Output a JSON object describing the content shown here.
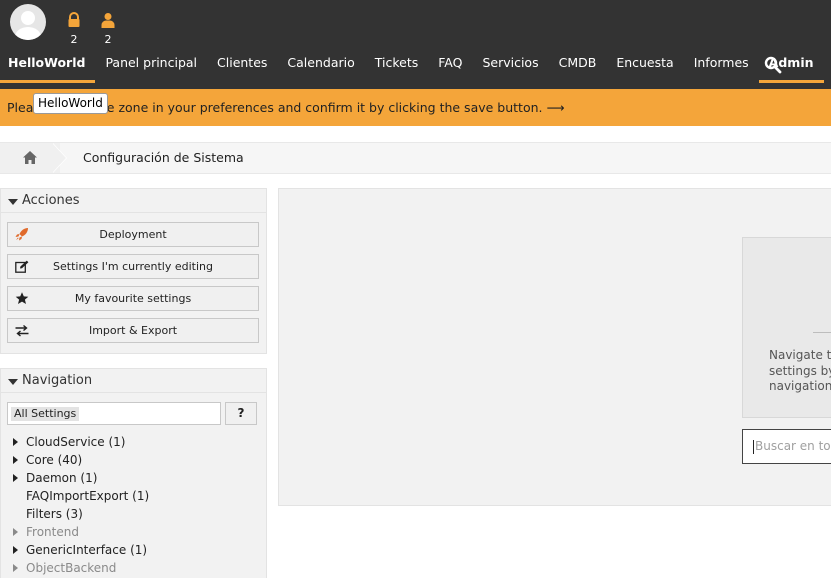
{
  "toolbar": {
    "locked_count": "2",
    "online_count": "2"
  },
  "nav": {
    "items": [
      {
        "label": "HelloWorld"
      },
      {
        "label": "Panel principal"
      },
      {
        "label": "Clientes"
      },
      {
        "label": "Calendario"
      },
      {
        "label": "Tickets"
      },
      {
        "label": "FAQ"
      },
      {
        "label": "Servicios"
      },
      {
        "label": "CMDB"
      },
      {
        "label": "Encuesta"
      },
      {
        "label": "Informes"
      },
      {
        "label": "Admin"
      }
    ],
    "active": [
      "HelloWorld",
      "Admin"
    ]
  },
  "notice": {
    "text": "Please set a time zone in your preferences and confirm it by clicking the save button. ⟶",
    "tooltip": "HelloWorld"
  },
  "breadcrumb": {
    "current": "Configuración de Sistema"
  },
  "actions": {
    "title": "Acciones",
    "buttons": [
      {
        "label": "Deployment",
        "icon": "rocket-icon"
      },
      {
        "label": "Settings I'm currently editing",
        "icon": "edit-icon"
      },
      {
        "label": "My favourite settings",
        "icon": "star-icon"
      },
      {
        "label": "Import & Export",
        "icon": "exchange-icon"
      }
    ]
  },
  "navigation": {
    "title": "Navigation",
    "filter_tag": "All Settings",
    "help_label": "?",
    "tree": [
      {
        "label": "CloudService (1)",
        "expandable": true,
        "disabled": false
      },
      {
        "label": "Core (40)",
        "expandable": true,
        "disabled": false
      },
      {
        "label": "Daemon (1)",
        "expandable": true,
        "disabled": false
      },
      {
        "label": "FAQImportExport (1)",
        "expandable": false,
        "disabled": false
      },
      {
        "label": "Filters (3)",
        "expandable": false,
        "disabled": false
      },
      {
        "label": "Frontend",
        "expandable": true,
        "disabled": true
      },
      {
        "label": "GenericInterface (1)",
        "expandable": true,
        "disabled": false
      },
      {
        "label": "ObjectBackend",
        "expandable": true,
        "disabled": true
      }
    ]
  },
  "content": {
    "placeholder_text": "Navigate th\nsettings by u\nnavigation b",
    "search_placeholder": "Buscar en todo"
  },
  "colors": {
    "topbar": "#333333",
    "accent": "#f4a53a",
    "panel": "#f2f2f2"
  }
}
